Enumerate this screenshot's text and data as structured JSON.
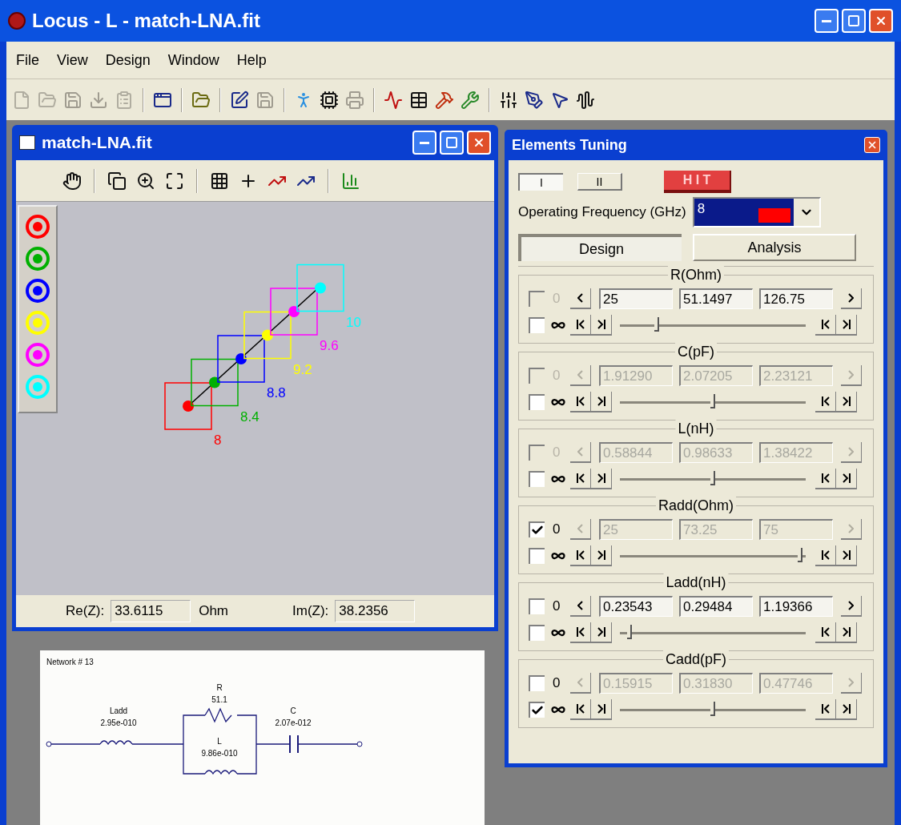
{
  "window": {
    "title": "Locus - L - match-LNA.fit"
  },
  "menu": [
    "File",
    "View",
    "Design",
    "Window",
    "Help"
  ],
  "child_window": {
    "title": "match-LNA.fit",
    "markers": [
      {
        "label": "8",
        "color": "#ff0000"
      },
      {
        "label": "8.4",
        "color": "#00b000"
      },
      {
        "label": "8.8",
        "color": "#0000ff"
      },
      {
        "label": "9.2",
        "color": "#ffff00"
      },
      {
        "label": "9.6",
        "color": "#ff00ff"
      },
      {
        "label": "10",
        "color": "#00ffff"
      }
    ],
    "status": {
      "re_label": "Re(Z):",
      "re_value": "33.6115",
      "unit": "Ohm",
      "im_label": "Im(Z):",
      "im_value": "38.2356"
    }
  },
  "schematic": {
    "title": "Network # 13",
    "components": [
      {
        "kind": "inductor",
        "name": "Ladd",
        "value": "2.95e-010"
      },
      {
        "kind": "resistor",
        "name": "R",
        "value": "51.1"
      },
      {
        "kind": "inductor",
        "name": "L",
        "value": "9.86e-010"
      },
      {
        "kind": "capacitor",
        "name": "C",
        "value": "2.07e-012"
      }
    ]
  },
  "tuning": {
    "title": "Elements Tuning",
    "layout_buttons": [
      {
        "label": "I",
        "selected": true
      },
      {
        "label": "II",
        "selected": false
      }
    ],
    "hit_button": "H I T",
    "frequency_label": "Operating Frequency (GHz)",
    "frequency_value": "8",
    "modes": [
      {
        "label": "Design",
        "selected": true
      },
      {
        "label": "Analysis",
        "selected": false
      }
    ],
    "elements": [
      {
        "name": "R(Ohm)",
        "zero_label": "0",
        "zero_enabled": false,
        "zero_checked": false,
        "inf_checked": false,
        "disabled": false,
        "min": "25",
        "value": "51.1497",
        "max": "126.75",
        "level": 0.2
      },
      {
        "name": "C(pF)",
        "zero_label": "0",
        "zero_enabled": false,
        "zero_checked": false,
        "inf_checked": false,
        "disabled": true,
        "min": "1.91290",
        "value": "2.07205",
        "max": "2.23121",
        "level": 0.5
      },
      {
        "name": "L(nH)",
        "zero_label": "0",
        "zero_enabled": false,
        "zero_checked": false,
        "inf_checked": false,
        "disabled": true,
        "min": "0.58844",
        "value": "0.98633",
        "max": "1.38422",
        "level": 0.5
      },
      {
        "name": "Radd(Ohm)",
        "zero_label": "0",
        "zero_enabled": true,
        "zero_checked": true,
        "inf_checked": false,
        "disabled": true,
        "min": "25",
        "value": "73.25",
        "max": "75",
        "level": 0.97
      },
      {
        "name": "Ladd(nH)",
        "zero_label": "0",
        "zero_enabled": true,
        "zero_checked": false,
        "inf_checked": false,
        "disabled": false,
        "min": "0.23543",
        "value": "0.29484",
        "max": "1.19366",
        "level": 0.05
      },
      {
        "name": "Cadd(pF)",
        "zero_label": "0",
        "zero_enabled": true,
        "zero_checked": false,
        "inf_checked": true,
        "disabled": true,
        "min": "0.15915",
        "value": "0.31830",
        "max": "0.47746",
        "level": 0.5
      }
    ]
  }
}
